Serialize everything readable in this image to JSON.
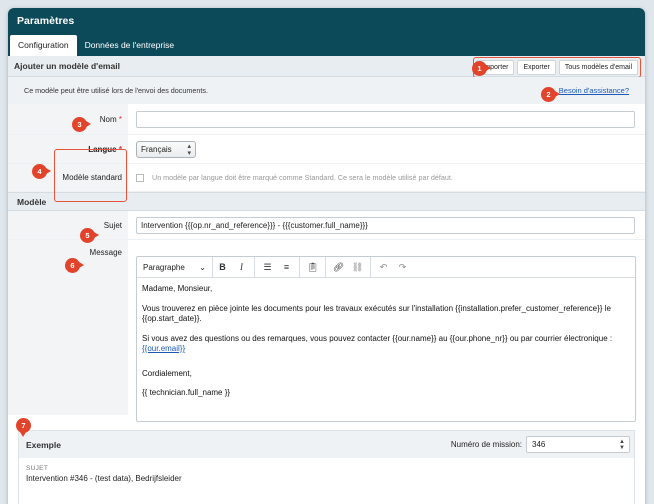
{
  "window": {
    "title": "Paramètres"
  },
  "tabs": [
    {
      "label": "Configuration",
      "active": true
    },
    {
      "label": "Données de l'entreprise",
      "active": false
    }
  ],
  "header": {
    "title": "Ajouter un modèle d'email",
    "buttons": {
      "import": "Importer",
      "export": "Exporter",
      "all": "Tous modèles d'email"
    }
  },
  "info": {
    "text": "Ce modèle peut être utilisé lors de l'envoi des documents.",
    "help_link": "Besoin d'assistance?"
  },
  "form": {
    "name_label": "Nom",
    "required_mark": "*",
    "name_value": "",
    "language_label": "Langue",
    "language_value": "Français",
    "standard_label": "Modèle standard",
    "standard_hint": "Un modèle par langue doit être marqué comme Standard. Ce sera le modèle utilisé par défaut."
  },
  "modele": {
    "section_title": "Modèle",
    "subject_label": "Sujet",
    "subject_value": "Intervention {{{op.nr_and_reference}}} - {{{customer.full_name}}}",
    "message_label": "Message",
    "toolbar": {
      "paragraph": "Paragraphe"
    },
    "body": {
      "greeting": "Madame, Monsieur,",
      "line1": "Vous trouverez en pièce jointe les documents pour les travaux exécutés sur l'installation {{installation.prefer_customer_reference}} le {{op.start_date}}.",
      "line2": "Si vous avez des questions ou des remarques, vous pouvez contacter {{our.name}} au {{our.phone_nr}} ou par courrier électronique :",
      "email_link": "{{our.email}}",
      "closing": "Cordialement,",
      "signature": "{{ technician.full_name }}"
    }
  },
  "example": {
    "title": "Exemple",
    "mission_label": "Numéro de mission:",
    "mission_value": "346",
    "subject_caption": "SUJET",
    "subject_value": "Intervention #346 - (test data), Bedrijfsleider"
  },
  "markers": [
    "1",
    "2",
    "3",
    "4",
    "5",
    "6",
    "7"
  ],
  "colors": {
    "header": "#0c4a5a",
    "marker": "#e2432b",
    "link": "#1d59b8"
  }
}
